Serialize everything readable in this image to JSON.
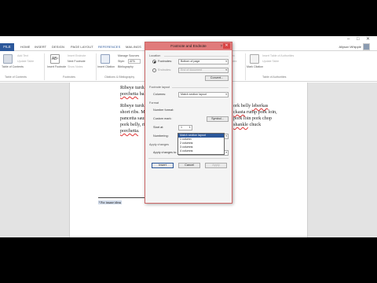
{
  "window": {
    "title": ""
  },
  "tabs": [
    "FILE",
    "HOME",
    "INSERT",
    "DESIGN",
    "PAGE LAYOUT",
    "REFERENCES",
    "MAILINGS",
    "REVIEW",
    "VIEW",
    "DEVELOPER"
  ],
  "active_tab": "REFERENCES",
  "user": {
    "name": "Allyson Whipple"
  },
  "ribbon": {
    "toc": {
      "big_label": "Table of Contents",
      "add_text": "Add Text",
      "update_table": "Update Table",
      "group": "Table of Contents"
    },
    "footnotes": {
      "insert_footnote": "Insert Footnote",
      "insert_endnote": "Insert Endnote",
      "next_footnote": "Next Footnote",
      "show_notes": "Show Notes",
      "group": "Footnotes"
    },
    "citations": {
      "insert_citation": "Insert Citation",
      "manage_sources": "Manage Sources",
      "style_label": "Style:",
      "style_value": "APA",
      "bibliography": "Bibliography",
      "group": "Citations & Bibliography"
    },
    "captions": {
      "insert_caption": "Insert Caption",
      "insert_tof": "Insert Table of Figures",
      "update_table": "Update Table",
      "cross_reference": "Cross-reference",
      "group": "Captions"
    },
    "index": {
      "mark_entry": "Mark Entry",
      "insert_index": "Insert Index",
      "update_index": "Update Index",
      "group": "Index"
    },
    "toa": {
      "mark_citation": "Mark Citation",
      "insert_toa": "Insert Table of Authorities",
      "update_table": "Update Table",
      "group": "Table of Authorities"
    }
  },
  "document": {
    "lines": [
      {
        "parts": [
          {
            "text": "Ribeye turducken bil",
            "sq": false
          }
        ]
      },
      {
        "parts": [
          {
            "text": "porchetta",
            "sq": true
          },
          {
            "text": " ball tip cow",
            "sq": false
          }
        ]
      },
      {
        "parts": [
          {
            "text": "Ribeye turducken bill",
            "sq": false
          }
        ]
      },
      {
        "parts": [
          {
            "text": "short ribs. Meatball",
            "sq": false
          }
        ]
      },
      {
        "parts": [
          {
            "text": "pancetta sausage pig",
            "sq": false
          }
        ]
      },
      {
        "parts": [
          {
            "text": "pork belly, ribeye pig",
            "sq": false
          }
        ]
      },
      {
        "parts": [
          {
            "text": "porchetta",
            "sq": true
          },
          {
            "text": ".",
            "sq": false
          }
        ]
      }
    ],
    "right_lines": [
      {
        "parts": [
          {
            "text": "ork belly ",
            "sq": false
          },
          {
            "text": "leberkas",
            "sq": true
          }
        ]
      },
      {
        "parts": [
          {
            "text": "ckasta",
            "sq": true
          },
          {
            "text": " rump pork loin,",
            "sq": false
          }
        ]
      },
      {
        "parts": [
          {
            "text": "pork loin pork chop",
            "sq": false
          }
        ]
      },
      {
        "parts": [
          {
            "text": "shankle",
            "sq": true
          },
          {
            "text": " chuck",
            "sq": false
          }
        ]
      }
    ],
    "footnote": "¹ For insane ideas"
  },
  "dialog": {
    "title": "Footnote and Endnote",
    "help": "?",
    "close": "✕",
    "location_section": "Location",
    "footnotes_label": "Footnotes:",
    "footnotes_value": "Bottom of page",
    "endnotes_label": "Endnotes:",
    "endnotes_value": "End of document",
    "convert_button": "Convert...",
    "layout_section": "Footnote layout",
    "columns_label": "Columns:",
    "columns_value": "Match section layout",
    "format_section": "Format",
    "number_format_label": "Number format:",
    "custom_mark_label": "Custom mark:",
    "symbol_button": "Symbol...",
    "start_at_label": "Start at:",
    "start_at_value": "1",
    "numbering_label": "Numbering:",
    "numbering_value": "Continuous",
    "apply_section": "Apply changes",
    "apply_to_label": "Apply changes to:",
    "apply_to_value": "Whole document",
    "insert_button": "Insert",
    "cancel_button": "Cancel",
    "apply_button": "Apply"
  },
  "columns_dropdown": {
    "options": [
      "Match section layout",
      "1 column",
      "2 columns",
      "3 columns",
      "4 columns"
    ],
    "highlighted": 0
  },
  "colors": {
    "accent": "#2b579a",
    "dialog_title": "#e07b7b",
    "close": "#d84545",
    "highlight": "#2b579a"
  }
}
